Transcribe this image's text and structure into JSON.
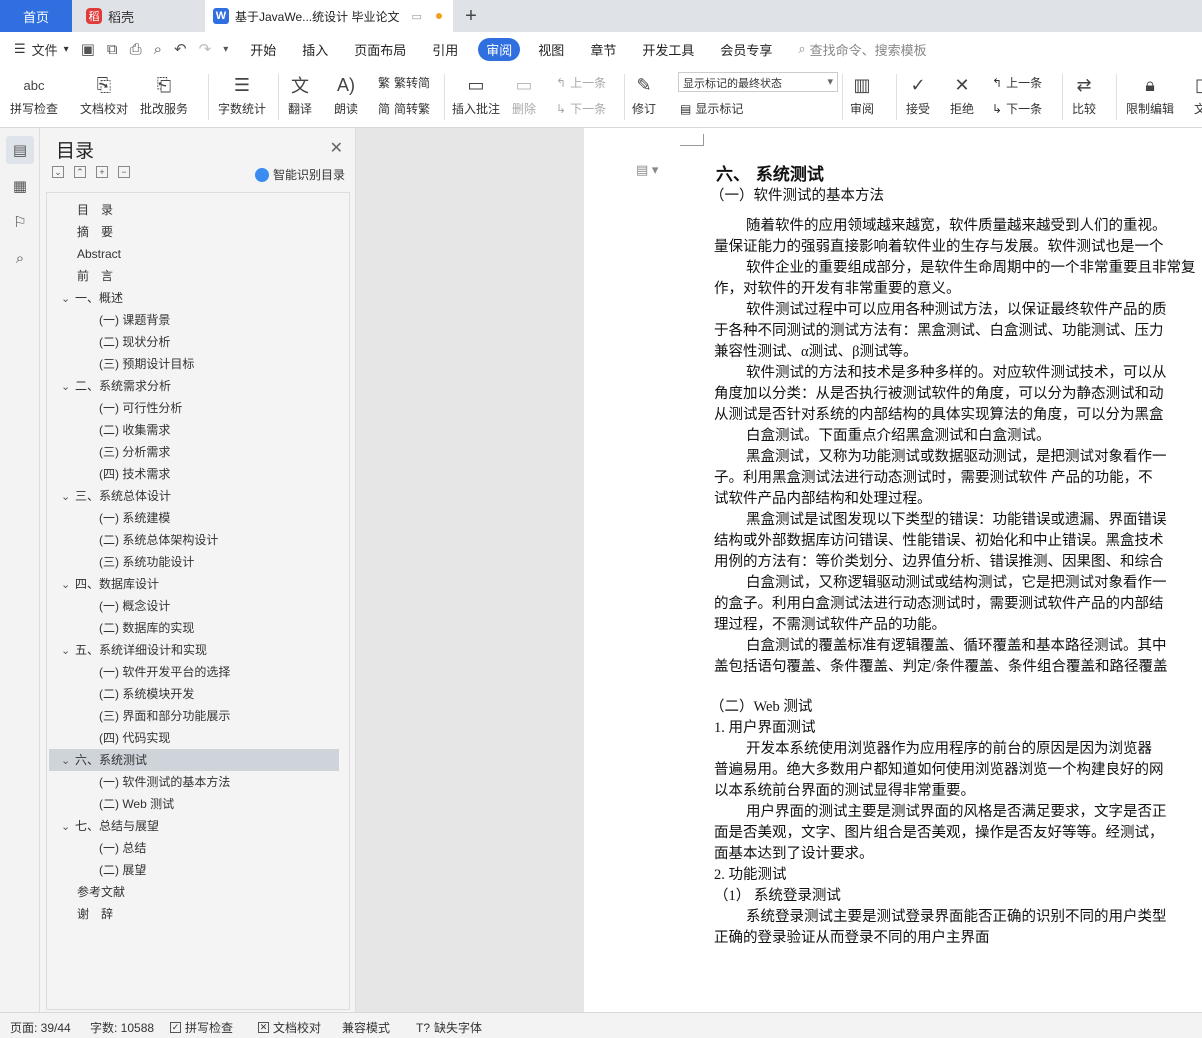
{
  "tabs": {
    "home": "首页",
    "daoke": "稻壳",
    "doc": "基于JavaWe...统设计 毕业论文",
    "plus": "+"
  },
  "menu": {
    "file": "文件",
    "items": [
      "开始",
      "插入",
      "页面布局",
      "引用",
      "审阅",
      "视图",
      "章节",
      "开发工具",
      "会员专享"
    ],
    "active": "审阅",
    "search": "查找命令、搜索模板"
  },
  "ribbon": {
    "spell_check": "拼写检查",
    "doc_proof": "文档校对",
    "batch_service": "批改服务",
    "word_count": "字数统计",
    "translate": "翻译",
    "read_aloud": "朗读",
    "trad_convert": "繁转简",
    "simp_convert": "简转繁",
    "insert_comment": "插入批注",
    "delete": "删除",
    "prev_comment": "上一条",
    "next_comment": "下一条",
    "revise": "修订",
    "markup_mode": "显示标记的最终状态",
    "show_markup": "显示标记",
    "review": "审阅",
    "accept": "接受",
    "reject": "拒绝",
    "prev_change": "上一条",
    "next_change": "下一条",
    "compare": "比较",
    "restrict_edit": "限制编辑",
    "doc_cut": "文"
  },
  "toc": {
    "title": "目录",
    "smart": "智能识别目录",
    "items": [
      {
        "text": "目　录",
        "level": 0
      },
      {
        "text": "摘　要",
        "level": 0
      },
      {
        "text": "Abstract",
        "level": 0
      },
      {
        "text": "前　言",
        "level": 0
      },
      {
        "text": "一、概述",
        "level": 1
      },
      {
        "text": "(一) 课题背景",
        "level": 2
      },
      {
        "text": "(二) 现状分析",
        "level": 2
      },
      {
        "text": "(三) 预期设计目标",
        "level": 2
      },
      {
        "text": "二、系统需求分析",
        "level": 1
      },
      {
        "text": "(一) 可行性分析",
        "level": 2
      },
      {
        "text": "(二) 收集需求",
        "level": 2
      },
      {
        "text": "(三) 分析需求",
        "level": 2
      },
      {
        "text": "(四) 技术需求",
        "level": 2
      },
      {
        "text": "三、系统总体设计",
        "level": 1
      },
      {
        "text": "(一) 系统建模",
        "level": 2
      },
      {
        "text": "(二) 系统总体架构设计",
        "level": 2
      },
      {
        "text": "(三) 系统功能设计",
        "level": 2
      },
      {
        "text": "四、数据库设计",
        "level": 1
      },
      {
        "text": "(一) 概念设计",
        "level": 2
      },
      {
        "text": "(二) 数据库的实现",
        "level": 2
      },
      {
        "text": "五、系统详细设计和实现",
        "level": 1
      },
      {
        "text": "(一) 软件开发平台的选择",
        "level": 2
      },
      {
        "text": "(二) 系统模块开发",
        "level": 2
      },
      {
        "text": "(三) 界面和部分功能展示",
        "level": 2
      },
      {
        "text": "(四) 代码实现",
        "level": 2
      },
      {
        "text": "六、系统测试",
        "level": 1,
        "selected": true
      },
      {
        "text": "(一) 软件测试的基本方法",
        "level": 2
      },
      {
        "text": "(二) Web 测试",
        "level": 2
      },
      {
        "text": "七、总结与展望",
        "level": 1
      },
      {
        "text": "(一) 总结",
        "level": 2
      },
      {
        "text": "(二) 展望",
        "level": 2
      },
      {
        "text": "参考文献",
        "level": 0
      },
      {
        "text": "谢　辞",
        "level": 0
      }
    ]
  },
  "document": {
    "lines": [
      {
        "text": "六、 系统测试",
        "style": "h1"
      },
      {
        "text": "（一）软件测试的基本方法",
        "style": "h2"
      },
      {
        "text": "随着软件的应用领域越来越宽，软件质量越来越受到人们的重视。",
        "style": "p"
      },
      {
        "text": "量保证能力的强弱直接影响着软件业的生存与发展。软件测试也是一个",
        "style": "p"
      },
      {
        "text": "软件企业的重要组成部分，是软件生命周期中的一个非常重要且非常复",
        "style": "p"
      },
      {
        "text": "作，对软件的开发有非常重要的意义。",
        "style": "p"
      },
      {
        "text": "软件测试过程中可以应用各种测试方法，以保证最终软件产品的质",
        "style": "p"
      },
      {
        "text": "于各种不同测试的测试方法有：黑盒测试、白盒测试、功能测试、压力",
        "style": "p"
      },
      {
        "text": "兼容性测试、α测试、β测试等。",
        "style": "p"
      },
      {
        "text": "软件测试的方法和技术是多种多样的。对应软件测试技术，可以从",
        "style": "p"
      },
      {
        "text": "角度加以分类：从是否执行被测试软件的角度，可以分为静态测试和动",
        "style": "p"
      },
      {
        "text": "从测试是否针对系统的内部结构的具体实现算法的角度，可以分为黑盒",
        "style": "p"
      },
      {
        "text": "白盒测试。下面重点介绍黑盒测试和白盒测试。",
        "style": "p"
      },
      {
        "text": "黑盒测试，又称为功能测试或数据驱动测试，是把测试对象看作一",
        "style": "p"
      },
      {
        "text": "子。利用黑盒测试法进行动态测试时，需要测试软件 产品的功能，不",
        "style": "p"
      },
      {
        "text": "试软件产品内部结构和处理过程。",
        "style": "p"
      },
      {
        "text": "黑盒测试是试图发现以下类型的错误：功能错误或遗漏、界面错误",
        "style": "p"
      },
      {
        "text": "结构或外部数据库访问错误、性能错误、初始化和中止错误。黑盒技术",
        "style": "p"
      },
      {
        "text": "用例的方法有：等价类划分、边界值分析、错误推测、因果图、和综合",
        "style": "p"
      },
      {
        "text": "白盒测试，又称逻辑驱动测试或结构测试，它是把测试对象看作一",
        "style": "p"
      },
      {
        "text": "的盒子。利用白盒测试法进行动态测试时，需要测试软件产品的内部结",
        "style": "p"
      },
      {
        "text": "理过程，不需测试软件产品的功能。",
        "style": "p"
      },
      {
        "text": "白盒测试的覆盖标准有逻辑覆盖、循环覆盖和基本路径测试。其中",
        "style": "p"
      },
      {
        "text": "盖包括语句覆盖、条件覆盖、判定/条件覆盖、条件组合覆盖和路径覆盖",
        "style": "p"
      },
      {
        "text": "（二）Web 测试",
        "style": "h2"
      },
      {
        "text": "1.  用户界面测试",
        "style": "h3"
      },
      {
        "text": "开发本系统使用浏览器作为应用程序的前台的原因是因为浏览器",
        "style": "p"
      },
      {
        "text": "普遍易用。绝大多数用户都知道如何使用浏览器浏览一个构建良好的网",
        "style": "p"
      },
      {
        "text": "以本系统前台界面的测试显得非常重要。",
        "style": "p"
      },
      {
        "text": "用户界面的测试主要是测试界面的风格是否满足要求，文字是否正",
        "style": "p"
      },
      {
        "text": "面是否美观，文字、图片组合是否美观，操作是否友好等等。经测试，",
        "style": "p"
      },
      {
        "text": "面基本达到了设计要求。",
        "style": "p"
      },
      {
        "text": "2.  功能测试",
        "style": "h3"
      },
      {
        "text": "（1）  系统登录测试",
        "style": "h3"
      },
      {
        "text": "系统登录测试主要是测试登录界面能否正确的识别不同的用户类型",
        "style": "p"
      },
      {
        "text": "正确的登录验证从而登录不同的用户主界面",
        "style": "p"
      }
    ]
  },
  "status": {
    "page": "页面: 39/44",
    "words": "字数: 10588",
    "spell": "拼写检查",
    "proof": "文档校对",
    "compat": "兼容模式",
    "missing_font": "缺失字体"
  }
}
